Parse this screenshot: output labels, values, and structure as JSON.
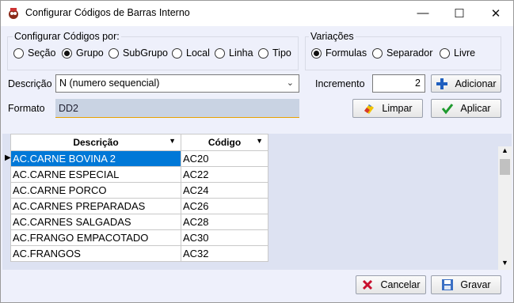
{
  "window": {
    "title": "Configurar Códigos de Barras Interno",
    "minimize": "—",
    "maximize": "☐",
    "close": "✕"
  },
  "config_group": {
    "title": "Configurar Códigos por:",
    "options": [
      {
        "label": "Seção",
        "selected": false
      },
      {
        "label": "Grupo",
        "selected": true
      },
      {
        "label": "SubGrupo",
        "selected": false
      },
      {
        "label": "Local",
        "selected": false
      },
      {
        "label": "Linha",
        "selected": false
      },
      {
        "label": "Tipo",
        "selected": false
      }
    ]
  },
  "variacoes_group": {
    "title": "Variações",
    "options": [
      {
        "label": "Formulas",
        "selected": true
      },
      {
        "label": "Separador",
        "selected": false
      },
      {
        "label": "Livre",
        "selected": false
      }
    ]
  },
  "form": {
    "descricao_label": "Descrição",
    "descricao_value": "N (numero sequencial)",
    "formato_label": "Formato",
    "formato_value": "DD2",
    "incremento_label": "Incremento",
    "incremento_value": "2"
  },
  "buttons": {
    "adicionar": "Adicionar",
    "limpar": "Limpar",
    "aplicar": "Aplicar",
    "cancelar": "Cancelar",
    "gravar": "Gravar"
  },
  "grid": {
    "columns": [
      "Descrição",
      "Código"
    ],
    "rows": [
      [
        "AC.CARNE BOVINA 2",
        "AC20"
      ],
      [
        "AC.CARNE ESPECIAL",
        "AC22"
      ],
      [
        "AC.CARNE PORCO",
        "AC24"
      ],
      [
        "AC.CARNES PREPARADAS",
        "AC26"
      ],
      [
        "AC.CARNES SALGADAS",
        "AC28"
      ],
      [
        "AC.FRANGO EMPACOTADO",
        "AC30"
      ],
      [
        "AC.FRANGOS",
        "AC32"
      ]
    ],
    "selected_row": 0
  },
  "colors": {
    "accent": "#0078d7",
    "panel": "#eef0fb",
    "readonly_field": "#c9d3e3"
  }
}
